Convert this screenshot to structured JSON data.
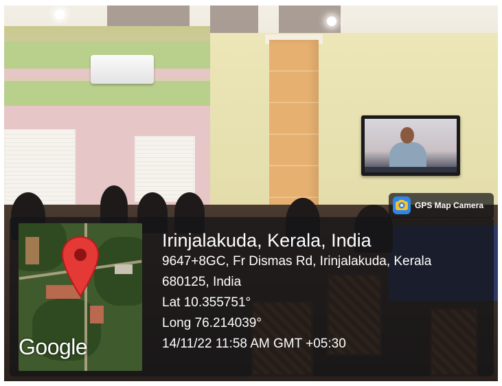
{
  "badge": {
    "icon": "gps-map-camera-icon",
    "label": "GPS Map Camera",
    "icon_color": "#2e87e8"
  },
  "map": {
    "provider_logo": "Google",
    "pin_icon": "map-pin-icon",
    "pin_color": "#e53935"
  },
  "location": {
    "title": "Irinjalakuda, Kerala, India",
    "address_line1": "9647+8GC, Fr Dismas Rd, Irinjalakuda, Kerala",
    "address_line2": "680125, India",
    "latitude": "Lat 10.355751°",
    "longitude": "Long 76.214039°",
    "timestamp": "14/11/22 11:58 AM GMT +05:30"
  },
  "overlay_color": "#141416"
}
